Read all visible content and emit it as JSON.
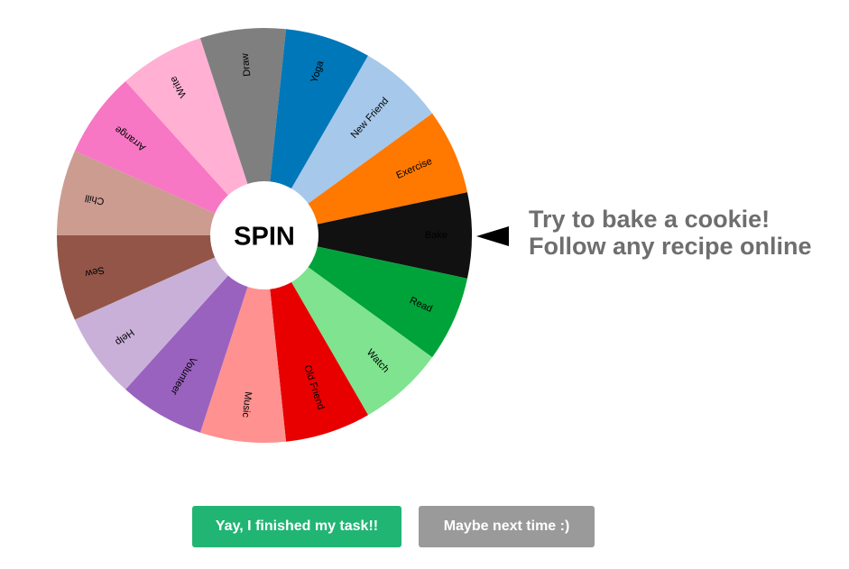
{
  "wheel": {
    "center_label": "SPIN",
    "segments": [
      {
        "label": "Bake",
        "color": "#111111"
      },
      {
        "label": "Read",
        "color": "#00a33a"
      },
      {
        "label": "Watch",
        "color": "#7fe38f"
      },
      {
        "label": "Old Friend",
        "color": "#e80000"
      },
      {
        "label": "Music",
        "color": "#ff9191"
      },
      {
        "label": "Volunteer",
        "color": "#9a62bf"
      },
      {
        "label": "Help",
        "color": "#c9b0d9"
      },
      {
        "label": "Sew",
        "color": "#925548"
      },
      {
        "label": "Chill",
        "color": "#cc9c91"
      },
      {
        "label": "Arrange",
        "color": "#f777c4"
      },
      {
        "label": "Write",
        "color": "#ffb0d3"
      },
      {
        "label": "Draw",
        "color": "#7f7f7f"
      },
      {
        "label": "Yoga",
        "color": "#0077b8"
      },
      {
        "label": "New Friend",
        "color": "#a6c8ea"
      },
      {
        "label": "Exercise",
        "color": "#ff7800"
      }
    ]
  },
  "result": {
    "line1": "Try to bake a cookie!",
    "line2": "Follow any recipe online"
  },
  "buttons": {
    "finish_label": "Yay, I finished my task!!",
    "finish_color": "#21b574",
    "later_label": "Maybe next time :)",
    "later_color": "#9a9a9a"
  }
}
